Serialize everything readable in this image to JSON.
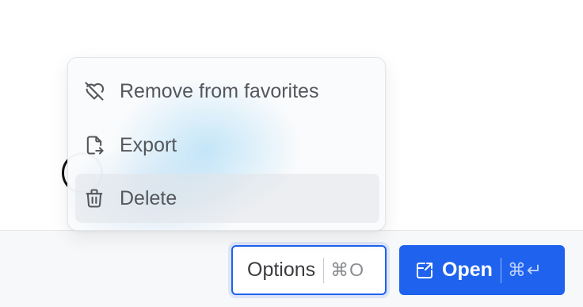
{
  "menu": {
    "items": [
      {
        "label": "Remove from favorites",
        "icon": "heart-off-icon"
      },
      {
        "label": "Export",
        "icon": "file-export-icon"
      },
      {
        "label": "Delete",
        "icon": "trash-icon"
      }
    ]
  },
  "actions": {
    "options": {
      "label": "Options",
      "shortcut": "⌘O"
    },
    "open": {
      "label": "Open",
      "shortcut": "⌘↵",
      "icon": "external-open-icon"
    }
  },
  "colors": {
    "primary": "#1e62ee",
    "menu_text": "#55575c",
    "muted": "#8a8c91"
  }
}
